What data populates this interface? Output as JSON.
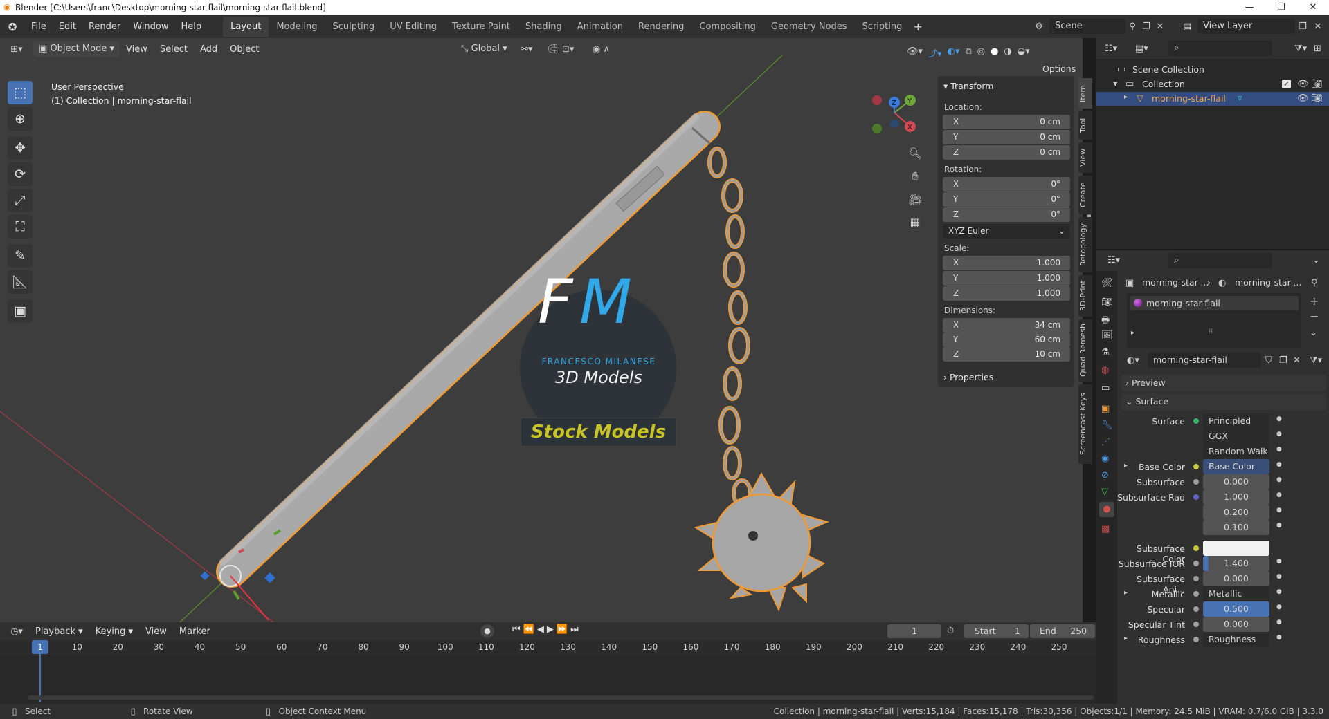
{
  "window": {
    "title": "Blender [C:\\Users\\franc\\Desktop\\morning-star-flail\\morning-star-flail.blend]",
    "minimize": "—",
    "maximize": "❐",
    "close": "✕"
  },
  "menu": [
    "File",
    "Edit",
    "Render",
    "Window",
    "Help"
  ],
  "workspaces": [
    "Layout",
    "Modeling",
    "Sculpting",
    "UV Editing",
    "Texture Paint",
    "Shading",
    "Animation",
    "Rendering",
    "Compositing",
    "Geometry Nodes",
    "Scripting"
  ],
  "active_workspace": "Layout",
  "scene": {
    "name": "Scene",
    "view_layer": "View Layer"
  },
  "viewport_header": {
    "mode": "Object Mode",
    "menus": [
      "View",
      "Select",
      "Add",
      "Object"
    ],
    "orientation": "Global",
    "options": "Options"
  },
  "viewport": {
    "perspective": "User Perspective",
    "collection_info": "(1) Collection | morning-star-flail",
    "watermark": {
      "monogram_f": "F",
      "monogram_m": "M",
      "name": "FRANCESCO MILANESE",
      "subtitle": "3D Models",
      "banner": "Stock Models"
    }
  },
  "npanel": {
    "section": "Transform",
    "location_label": "Location:",
    "location": [
      {
        "axis": "X",
        "value": "0 cm"
      },
      {
        "axis": "Y",
        "value": "0 cm"
      },
      {
        "axis": "Z",
        "value": "0 cm"
      }
    ],
    "rotation_label": "Rotation:",
    "rotation": [
      {
        "axis": "X",
        "value": "0°"
      },
      {
        "axis": "Y",
        "value": "0°"
      },
      {
        "axis": "Z",
        "value": "0°"
      }
    ],
    "rotation_mode": "XYZ Euler",
    "scale_label": "Scale:",
    "scale": [
      {
        "axis": "X",
        "value": "1.000"
      },
      {
        "axis": "Y",
        "value": "1.000"
      },
      {
        "axis": "Z",
        "value": "1.000"
      }
    ],
    "dimensions_label": "Dimensions:",
    "dimensions": [
      {
        "axis": "X",
        "value": "34 cm"
      },
      {
        "axis": "Y",
        "value": "60 cm"
      },
      {
        "axis": "Z",
        "value": "10 cm"
      }
    ],
    "properties": "Properties",
    "tabs": [
      "Item",
      "Tool",
      "View",
      "Create",
      "Retopology",
      "3D-Print",
      "Quad Remesh",
      "Screencast Keys"
    ]
  },
  "outliner": {
    "scene_collection": "Scene Collection",
    "collection": "Collection",
    "object": "morning-star-flail"
  },
  "properties": {
    "breadcrumb_object": "morning-star-...",
    "breadcrumb_material": "morning-star-...",
    "slot": "morning-star-flail",
    "material_name": "morning-star-flail",
    "preview": "Preview",
    "surface_section": "Surface",
    "rows": [
      {
        "label": "Surface",
        "value": "Principled BSDF",
        "dot": "#3cb371"
      },
      {
        "label": "",
        "value": "GGX",
        "dot": ""
      },
      {
        "label": "",
        "value": "Random Walk",
        "dot": ""
      },
      {
        "label": "Base Color",
        "value": "Base Color",
        "dot": "#c8c83c"
      },
      {
        "label": "Subsurface",
        "value": "0.000",
        "dot": "#a0a0a0"
      },
      {
        "label": "Subsurface Rad",
        "value": "1.000",
        "dot": "#6363c7"
      },
      {
        "label": "",
        "value": "0.200",
        "dot": ""
      },
      {
        "label": "",
        "value": "0.100",
        "dot": ""
      },
      {
        "label": "Subsurface Color",
        "value": "",
        "dot": "#c8c83c"
      },
      {
        "label": "Subsurface IOR",
        "value": "1.400",
        "dot": "#a0a0a0"
      },
      {
        "label": "Subsurface Ani...",
        "value": "0.000",
        "dot": "#a0a0a0"
      },
      {
        "label": "Metallic",
        "value": "Metallic",
        "dot": "#a0a0a0"
      },
      {
        "label": "Specular",
        "value": "0.500",
        "dot": "#a0a0a0"
      },
      {
        "label": "Specular Tint",
        "value": "0.000",
        "dot": "#a0a0a0"
      },
      {
        "label": "Roughness",
        "value": "Roughness",
        "dot": "#a0a0a0"
      }
    ]
  },
  "timeline": {
    "menus": [
      "Playback",
      "Keying",
      "View",
      "Marker"
    ],
    "current_frame": "1",
    "start_label": "Start",
    "start": "1",
    "end_label": "End",
    "end": "250",
    "ticks": [
      "1",
      "10",
      "20",
      "30",
      "40",
      "50",
      "60",
      "70",
      "80",
      "90",
      "100",
      "110",
      "120",
      "130",
      "140",
      "150",
      "160",
      "170",
      "180",
      "190",
      "200",
      "210",
      "220",
      "230",
      "240",
      "250"
    ]
  },
  "statusbar": {
    "select": "Select",
    "rotate": "Rotate View",
    "context": "Object Context Menu",
    "stats": "Collection | morning-star-flail | Verts:15,184 | Faces:15,178 | Tris:30,356 | Objects:1/1 | Memory: 24.5 MiB | VRAM: 0.7/6.0 GiB | 3.3.0"
  },
  "colors": {
    "accent": "#4772b3",
    "selected": "#f09a35",
    "header": "#303030"
  }
}
